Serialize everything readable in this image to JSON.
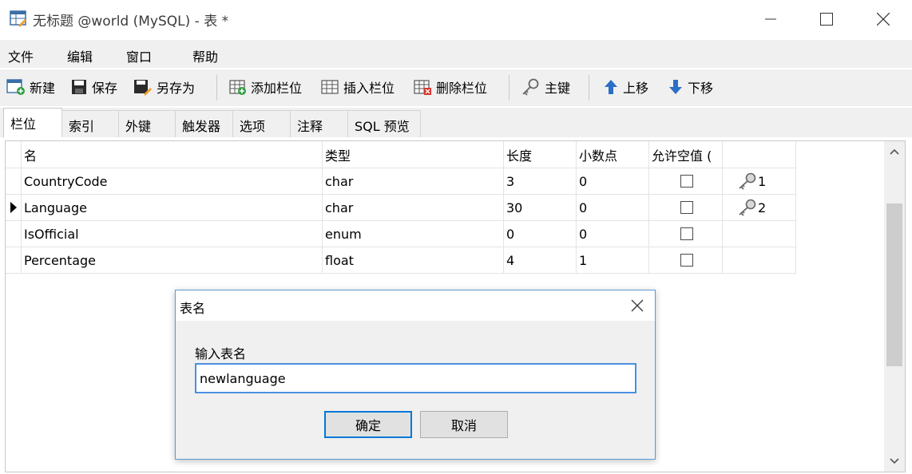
{
  "window": {
    "title": "无标题 @world (MySQL) - 表 *"
  },
  "menu": [
    "文件",
    "编辑",
    "窗口",
    "帮助"
  ],
  "toolbar": {
    "new_label": "新建",
    "save_label": "保存",
    "save_as_label": "另存为",
    "add_column_label": "添加栏位",
    "insert_column_label": "插入栏位",
    "delete_column_label": "删除栏位",
    "primary_key_label": "主键",
    "move_up_label": "上移",
    "move_down_label": "下移"
  },
  "tabs": [
    "栏位",
    "索引",
    "外键",
    "触发器",
    "选项",
    "注释",
    "SQL 预览"
  ],
  "grid": {
    "headers": [
      "名",
      "类型",
      "长度",
      "小数点",
      "允许空值 (",
      ""
    ],
    "rows": [
      {
        "name": "CountryCode",
        "type": "char",
        "length": "3",
        "decimals": "0",
        "allow_null": false,
        "key": "1"
      },
      {
        "name": "Language",
        "type": "char",
        "length": "30",
        "decimals": "0",
        "allow_null": false,
        "key": "2"
      },
      {
        "name": "IsOfficial",
        "type": "enum",
        "length": "0",
        "decimals": "0",
        "allow_null": false,
        "key": ""
      },
      {
        "name": "Percentage",
        "type": "float",
        "length": "4",
        "decimals": "1",
        "allow_null": false,
        "key": ""
      }
    ],
    "current_row": 1
  },
  "dialog": {
    "title": "表名",
    "label": "输入表名",
    "input_value": "newlanguage",
    "ok_label": "确定",
    "cancel_label": "取消"
  },
  "colors": {
    "accent": "#0078d7",
    "input_border": "#4a8fe0",
    "chrome": "#f0f0f0"
  }
}
